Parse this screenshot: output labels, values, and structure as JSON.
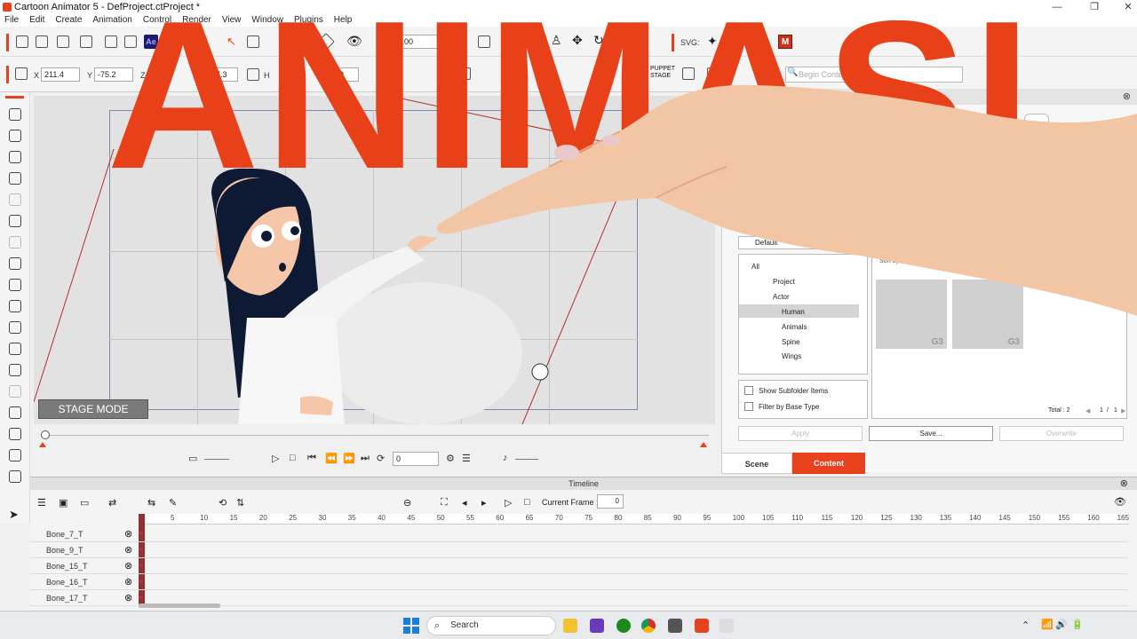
{
  "window": {
    "title": "Cartoon Animator 5 - DefProject.ctProject *"
  },
  "menu": [
    "File",
    "Edit",
    "Create",
    "Animation",
    "Control",
    "Render",
    "View",
    "Window",
    "Plugins",
    "Help"
  ],
  "toolbar": {
    "zoom_value": "100",
    "svg_label": "SVG:",
    "ae_label": "Ae",
    "m_label": "M"
  },
  "transform": {
    "x_label": "X",
    "x_value": "211.4",
    "y_label": "Y",
    "y_value": "-75.2",
    "z_label": "Z",
    "z_value": "37.3",
    "h_label": "H",
    "h_value": "289",
    "puppet_stage": "PUPPET\nSTAGE",
    "search_placeholder": "Begin Content Search"
  },
  "stage": {
    "mode_label": "STAGE MODE"
  },
  "playback": {
    "frame_value": "0"
  },
  "panel": {
    "header": "Content",
    "dropdown": "Default",
    "sort_label": "Sort by",
    "tree": [
      "All",
      "Project",
      "Actor",
      "Human",
      "Animals",
      "Spine",
      "Wings"
    ],
    "selected": "Human",
    "checkbox_subfolder": "Show Subfolder Items",
    "checkbox_filter": "Filter by Base Type",
    "thumb_badge": "G3",
    "total": "Total : 2",
    "page_current": "1",
    "page_sep": "/",
    "page_total": "1",
    "apply": "Apply",
    "save": "Save...",
    "overwrite": "Overwrite",
    "tab_scene": "Scene",
    "tab_content": "Content"
  },
  "timeline": {
    "header": "Timeline",
    "current_frame_label": "Current Frame :",
    "current_frame_value": "0",
    "ruler_ticks": [
      "5",
      "10",
      "15",
      "20",
      "25",
      "30",
      "35",
      "40",
      "45",
      "50",
      "55",
      "60",
      "65",
      "70",
      "75",
      "80",
      "85",
      "90",
      "95",
      "100",
      "105",
      "110",
      "115",
      "120",
      "125",
      "130",
      "135",
      "140",
      "145",
      "150",
      "155",
      "160",
      "165"
    ],
    "tracks": [
      "Bone_7_T",
      "Bone_9_T",
      "Bone_15_T",
      "Bone_16_T",
      "Bone_17_T"
    ]
  },
  "taskbar": {
    "search_label": "Search"
  },
  "overlay": {
    "text": "ANIMASI"
  },
  "colors": {
    "accent": "#e8421c",
    "overlay": "#e8411a",
    "stage_bg": "#e2e2e2",
    "tab_active": "#e8421c"
  }
}
